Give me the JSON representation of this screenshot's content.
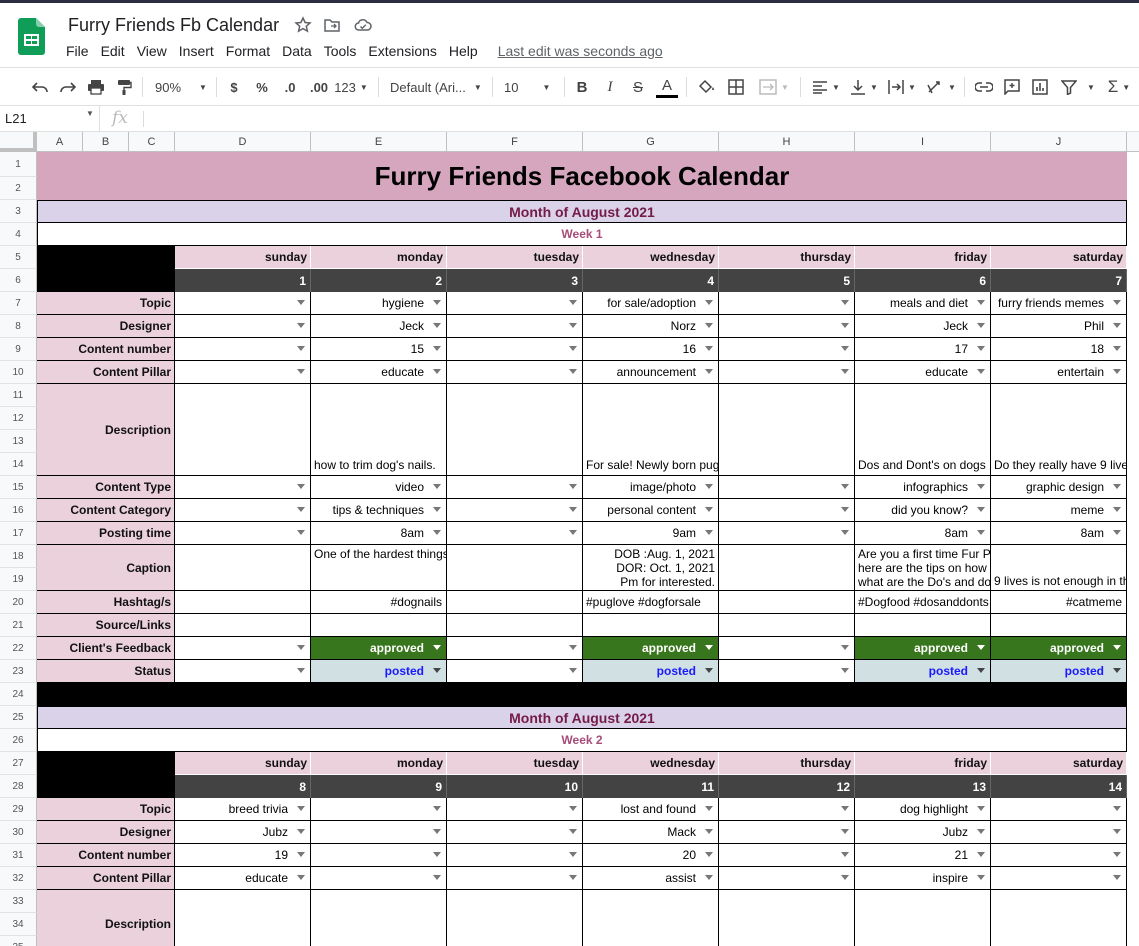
{
  "app": {
    "doc_title": "Furry Friends Fb Calendar",
    "menus": [
      "File",
      "Edit",
      "View",
      "Insert",
      "Format",
      "Data",
      "Tools",
      "Extensions",
      "Help"
    ],
    "last_edit": "Last edit was seconds ago"
  },
  "toolbar": {
    "zoom": "90%",
    "currency": "$",
    "percent": "%",
    "decimal_decrease": ".0",
    "decimal_increase": ".00",
    "more_formats": "123",
    "font": "Default (Ari...",
    "font_size": "10",
    "bold": "B",
    "italic": "I",
    "strike": "S",
    "text_color": "A"
  },
  "formula_bar": {
    "cell_ref": "L21",
    "fx": "fx"
  },
  "columns": [
    "A",
    "B",
    "C",
    "D",
    "E",
    "F",
    "G",
    "H",
    "I",
    "J"
  ],
  "rows": [
    "1",
    "2",
    "3",
    "4",
    "5",
    "6",
    "7",
    "8",
    "9",
    "10",
    "11",
    "12",
    "13",
    "14",
    "15",
    "16",
    "17",
    "18",
    "19",
    "20",
    "21",
    "22",
    "23",
    "24",
    "25",
    "26",
    "27",
    "28",
    "29",
    "30",
    "31",
    "32",
    "33",
    "34",
    "35"
  ],
  "sheet": {
    "title": "Furry Friends Facebook Calendar",
    "labels": {
      "topic": "Topic",
      "designer": "Designer",
      "content_number": "Content number",
      "content_pillar": "Content Pillar",
      "description": "Description",
      "content_type": "Content Type",
      "content_category": "Content Category",
      "posting_time": "Posting time",
      "caption": "Caption",
      "hashtags": "Hashtag/s",
      "source": "Source/Links",
      "feedback": "Client's Feedback",
      "status": "Status"
    },
    "days": [
      "sunday",
      "monday",
      "tuesday",
      "wednesday",
      "thursday",
      "friday",
      "saturday"
    ],
    "week1": {
      "month": "Month of August 2021",
      "week": "Week 1",
      "dates": [
        "1",
        "2",
        "3",
        "4",
        "5",
        "6",
        "7"
      ],
      "topic": [
        "",
        "hygiene",
        "",
        "for sale/adoption",
        "",
        "meals and diet",
        "furry friends memes"
      ],
      "designer": [
        "",
        "Jeck",
        "",
        "Norz",
        "",
        "Jeck",
        "Phil"
      ],
      "content_number": [
        "",
        "15",
        "",
        "16",
        "",
        "17",
        "18"
      ],
      "content_pillar": [
        "",
        "educate",
        "",
        "announcement",
        "",
        "educate",
        "entertain"
      ],
      "description": [
        "",
        "how to trim dog's nails.",
        "",
        "For sale! Newly born pug",
        "",
        "Dos and Dont's on dogs",
        "Do they really have 9 live"
      ],
      "content_type": [
        "",
        "video",
        "",
        "image/photo",
        "",
        "infographics",
        "graphic design"
      ],
      "content_category": [
        "",
        "tips & techniques",
        "",
        "personal content",
        "",
        "did you know?",
        "meme"
      ],
      "posting_time": [
        "",
        "8am",
        "",
        "9am",
        "",
        "8am",
        "8am"
      ],
      "caption_monday": "One of the hardest things",
      "caption_wednesday": [
        "DOB :Aug. 1, 2021",
        "DOR: Oct. 1, 2021",
        "Pm for interested."
      ],
      "caption_friday": [
        "Are you a first time Fur P",
        "here are the tips on how",
        "what are the Do's and do"
      ],
      "caption_saturday": "9 lives is not enough in th",
      "hashtags": [
        "",
        "#dognails",
        "",
        "#puglove #dogforsale",
        "",
        "#Dogfood #dosanddonts",
        "#catmeme"
      ],
      "feedback": [
        "",
        "approved",
        "",
        "approved",
        "",
        "approved",
        "approved"
      ],
      "status": [
        "",
        "posted",
        "",
        "posted",
        "",
        "posted",
        "posted"
      ]
    },
    "week2": {
      "month": "Month of August 2021",
      "week": "Week 2",
      "dates": [
        "8",
        "9",
        "10",
        "11",
        "12",
        "13",
        "14"
      ],
      "topic": [
        "breed trivia",
        "",
        "",
        "lost and found",
        "",
        "dog highlight",
        ""
      ],
      "designer": [
        "Jubz",
        "",
        "",
        "Mack",
        "",
        "Jubz",
        ""
      ],
      "content_number": [
        "19",
        "",
        "",
        "20",
        "",
        "21",
        ""
      ],
      "content_pillar": [
        "educate",
        "",
        "",
        "assist",
        "",
        "inspire",
        ""
      ]
    }
  },
  "colors": {
    "title_bg": "#d5a6bd",
    "label_bg": "#ead1dc",
    "month_bg": "#d9d2e9",
    "approved": "#38761d",
    "posted_bg": "#d0e0e3",
    "date_bg": "#434343"
  }
}
